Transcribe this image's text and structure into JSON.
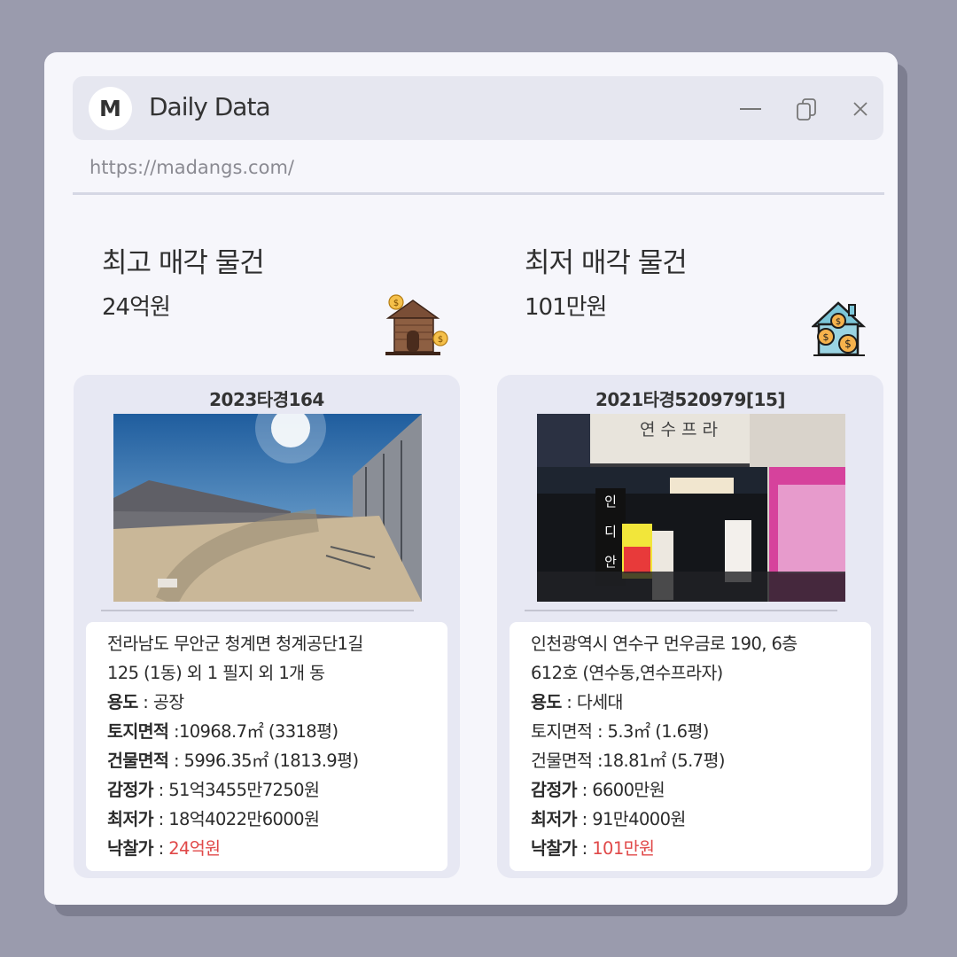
{
  "window": {
    "logo_letter": "M",
    "title": "Daily Data",
    "url": "https://madangs.com/"
  },
  "highest": {
    "heading": "최고 매각 물건",
    "value": "24억원",
    "icon": "house-money-icon",
    "card": {
      "case_no": "2023타경164",
      "address_line1": "전라남도 무안군 청계면 청계공단1길",
      "address_line2": "125 (1동) 외 1 필지 외 1개 동",
      "usage_label": "용도",
      "usage_value": " : 공장",
      "land_label": "토지면적",
      "land_value": " :10968.7㎡ (3318평)",
      "building_label": "건물면적",
      "building_value": " : 5996.35㎡ (1813.9평)",
      "appraisal_label": "감정가",
      "appraisal_value": " : 51억3455만7250원",
      "minimum_label": "최저가",
      "minimum_value": " : 18억4022만6000원",
      "winning_label": "낙찰가",
      "winning_sep": " : ",
      "winning_value": "24억원"
    }
  },
  "lowest": {
    "heading": "최저 매각 물건",
    "value": "101만원",
    "icon": "house-coins-icon",
    "card": {
      "case_no": "2021타경520979[15]",
      "address_line1": "인천광역시 연수구 먼우금로 190, 6층",
      "address_line2": "612호 (연수동,연수프라자)",
      "usage_label": "용도",
      "usage_value": " : 다세대",
      "land_label": "토지면적",
      "land_value": " : 5.3㎡ (1.6평)",
      "building_label": "건물면적",
      "building_value": " :18.81㎡ (5.7평)",
      "appraisal_label": "감정가",
      "appraisal_value": " : 6600만원",
      "minimum_label": "최저가",
      "minimum_value": " : 91만4000원",
      "winning_label": "낙찰가",
      "winning_sep": " : ",
      "winning_value": "101만원"
    },
    "sign_text": "연 수 프 라"
  },
  "colors": {
    "background": "#9a9bad",
    "window": "#f6f6fb",
    "titlebar": "#e6e7f0",
    "card": "#e7e8f3",
    "price_red": "#e04848"
  }
}
